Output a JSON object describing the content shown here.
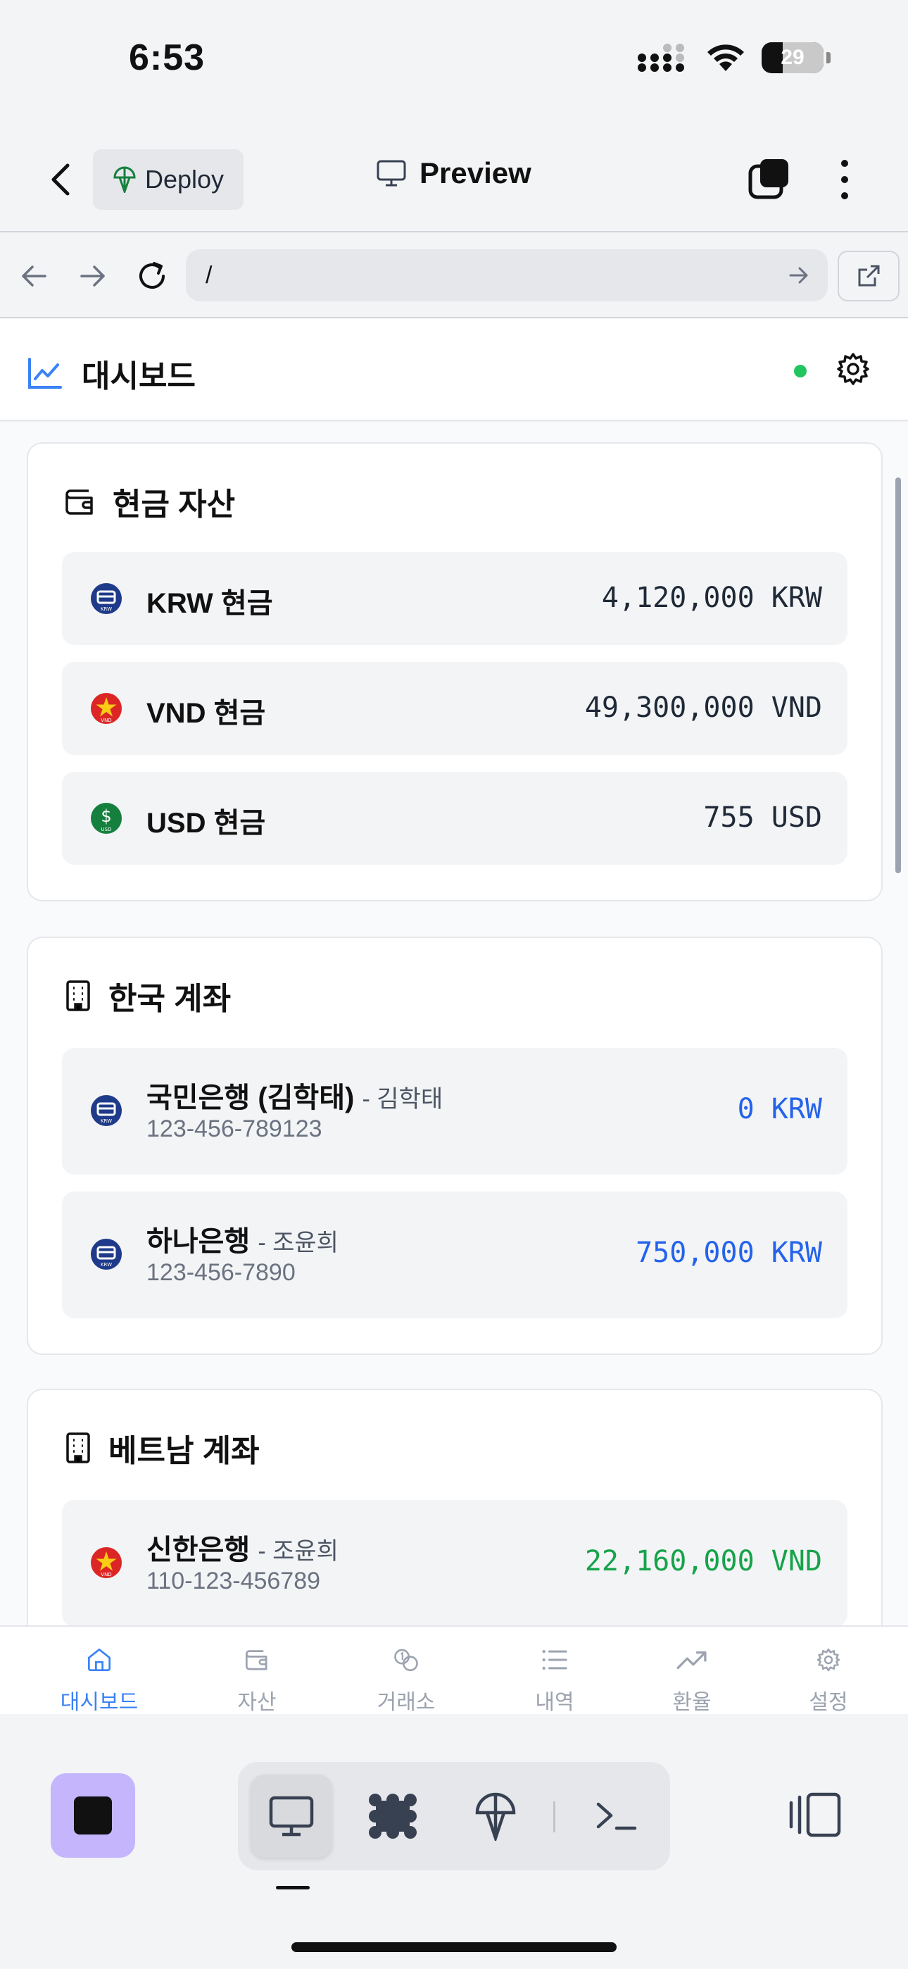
{
  "status_bar": {
    "time": "6:53",
    "battery": "29"
  },
  "header": {
    "deploy_label": "Deploy",
    "title": "Preview"
  },
  "url_bar": {
    "url": "/"
  },
  "app": {
    "title": "대시보드"
  },
  "cash_card": {
    "title": "현금 자산",
    "items": [
      {
        "label": "KRW 현금",
        "value": "4,120,000 KRW",
        "icon": "krw-coin-icon"
      },
      {
        "label": "VND 현금",
        "value": "49,300,000 VND",
        "icon": "vnd-flag-icon"
      },
      {
        "label": "USD 현금",
        "value": "755 USD",
        "icon": "usd-coin-icon"
      }
    ]
  },
  "korea_card": {
    "title": "한국 계좌",
    "items": [
      {
        "bank": "국민은행 (김학태)",
        "owner": "- 김학태",
        "account": "123-456-789123",
        "value": "0 KRW"
      },
      {
        "bank": "하나은행",
        "owner": "- 조윤희",
        "account": "123-456-7890",
        "value": "750,000 KRW"
      }
    ]
  },
  "vietnam_card": {
    "title": "베트남 계좌",
    "items": [
      {
        "bank": "신한은행",
        "owner": "- 조윤희",
        "account": "110-123-456789",
        "value": "22,160,000 VND"
      }
    ]
  },
  "tabbar": {
    "tabs": [
      {
        "label": "대시보드",
        "icon": "home-icon",
        "active": true
      },
      {
        "label": "자산",
        "icon": "wallet-icon"
      },
      {
        "label": "거래소",
        "icon": "coins-icon"
      },
      {
        "label": "내역",
        "icon": "list-icon"
      },
      {
        "label": "환율",
        "icon": "trending-up-icon"
      },
      {
        "label": "설정",
        "icon": "settings-icon"
      }
    ]
  },
  "colors": {
    "accent": "#3b82f6",
    "positive": "#16a34a",
    "stop_button": "#c4b5fd",
    "live": "#22c55e"
  }
}
